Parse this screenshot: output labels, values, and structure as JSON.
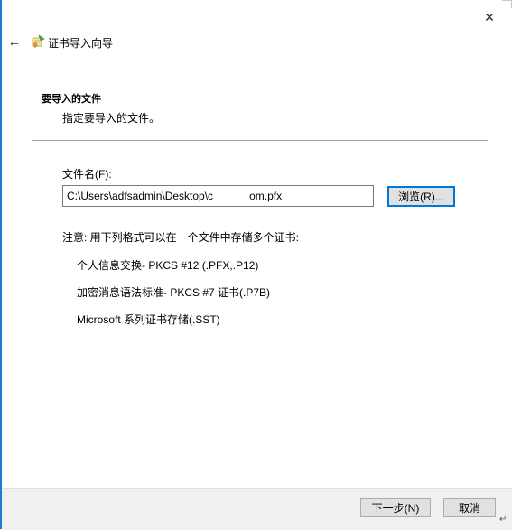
{
  "window": {
    "close_glyph": "✕",
    "back_glyph": "←",
    "title": "证书导入向导",
    "icon": "certificate-wizard-icon"
  },
  "section": {
    "heading": "要导入的文件",
    "description": "指定要导入的文件。"
  },
  "file": {
    "label": "文件名(F):",
    "value": "C:\\Users\\adfsadmin\\Desktop\\c            om.pfx",
    "browse_label": "浏览(R)..."
  },
  "note": {
    "text": "注意: 用下列格式可以在一个文件中存储多个证书:",
    "formats": [
      "个人信息交换- PKCS #12 (.PFX,.P12)",
      "加密消息语法标准- PKCS #7 证书(.P7B)",
      "Microsoft 系列证书存储(.SST)"
    ]
  },
  "footer": {
    "next_label": "下一步(N)",
    "cancel_label": "取消",
    "return_glyph": "↵"
  },
  "colors": {
    "accent": "#0078d7",
    "footer_bg": "#f0f0f0",
    "left_edge": "#1f7cd1"
  }
}
